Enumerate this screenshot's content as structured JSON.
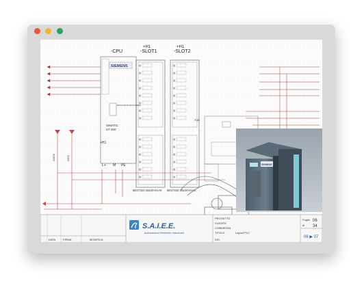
{
  "window": {
    "controls": [
      "close",
      "minimize",
      "maximize"
    ],
    "colors": {
      "close": "#e9553f",
      "minimize": "#f2b431",
      "maximize": "#2aa45c"
    }
  },
  "schematic": {
    "columns": {
      "cpu": "-CPU",
      "slot1_top": "+H1",
      "slot1": "-SLOT1",
      "slot2_top": "+H1",
      "slot2": "-SLOT2"
    },
    "brand": "SIEMENS",
    "model": "SIMATIC\nS7-300",
    "h1_label": "+H1",
    "mode_labels": "RUN-P\nRUN\nSTOP\nMRES",
    "slot1_part": "6ES7321-1BL00-0AA0",
    "slot2_part": "6ES7322-1BL00-0AA0",
    "power_labels": [
      "L+",
      "M",
      "PE"
    ],
    "a11_label": "A11",
    "title_block": {
      "company": "S.A.I.E.E.",
      "company_sub": "automazioni Elettriche Industriali",
      "fields": [
        "PROGETTO",
        "CLIENTE",
        "COMMESSA",
        "TITOLO",
        "DIS."
      ],
      "title_value": "Layout PLC",
      "foglio_label": "Foglio",
      "foglio_value": "06",
      "di_label": "di",
      "di_value": "34",
      "page_nav": "06 ▶ 07",
      "rev_headers": [
        "DATA",
        "FIRMA",
        "MODIFICA"
      ]
    }
  }
}
